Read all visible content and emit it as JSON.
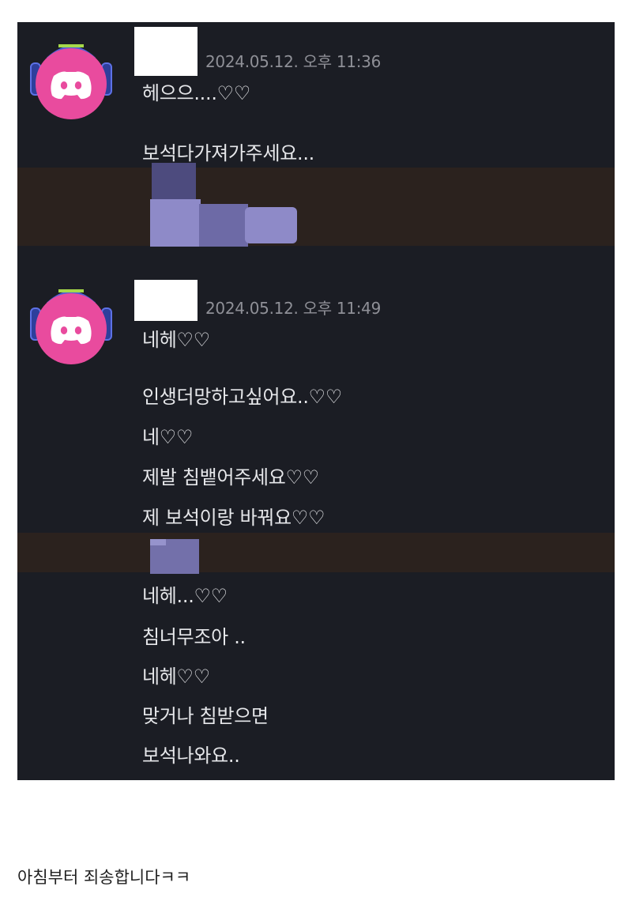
{
  "colors": {
    "chat_background": "#1b1d24",
    "message_text": "#e6e7ea",
    "timestamp_text": "#8f9097",
    "avatar_accent": "#e94b9e",
    "highlight_band": "#2b221e",
    "blurred_block": "#8e8ac8"
  },
  "groups": [
    {
      "timestamp": "2024.05.12. 오후 11:36",
      "messages": [
        "헤으으....♡♡",
        "보석다가져가주세요..."
      ]
    },
    {
      "timestamp": "2024.05.12. 오후 11:49",
      "messages": [
        "네헤♡♡",
        "인생더망하고싶어요..♡♡",
        "네♡♡",
        "제발 침뱉어주세요♡♡",
        "제 보석이랑 바꿔요♡♡"
      ]
    }
  ],
  "continuation_messages": [
    "네헤...♡♡",
    "침너무조아 ..",
    "네헤♡♡",
    "맞거나 침받으면",
    "보석나와요.."
  ],
  "footer_text": "아침부터 죄송합니다ㅋㅋ",
  "icons": {
    "avatar": "discord-logo-icon"
  }
}
